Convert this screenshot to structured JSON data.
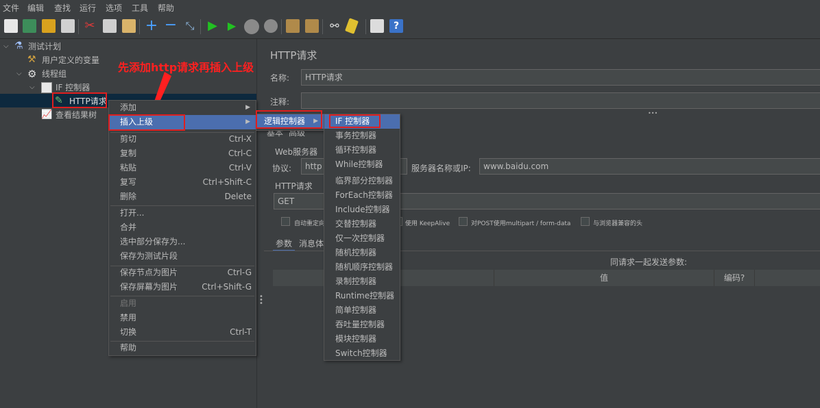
{
  "menubar": [
    "文件",
    "编辑",
    "查找",
    "运行",
    "选项",
    "工具",
    "帮助"
  ],
  "tree": {
    "items": [
      {
        "label": "测试计划"
      },
      {
        "label": "用户定义的变量"
      },
      {
        "label": "线程组"
      },
      {
        "label": "IF 控制器"
      },
      {
        "label": "HTTP请求"
      },
      {
        "label": "查看结果树"
      }
    ]
  },
  "annotation": "先添加http请求再插入上级",
  "context_menu": {
    "items": [
      {
        "label": "添加",
        "submenu": true
      },
      {
        "label": "插入上级",
        "submenu": true,
        "selected": true
      },
      {
        "label": "剪切",
        "shortcut": "Ctrl-X"
      },
      {
        "label": "复制",
        "shortcut": "Ctrl-C"
      },
      {
        "label": "粘贴",
        "shortcut": "Ctrl-V"
      },
      {
        "label": "复写",
        "shortcut": "Ctrl+Shift-C"
      },
      {
        "label": "删除",
        "shortcut": "Delete"
      },
      {
        "label": "打开..."
      },
      {
        "label": "合并"
      },
      {
        "label": "选中部分保存为..."
      },
      {
        "label": "保存为测试片段"
      },
      {
        "label": "保存节点为图片",
        "shortcut": "Ctrl-G"
      },
      {
        "label": "保存屏幕为图片",
        "shortcut": "Ctrl+Shift-G"
      },
      {
        "label": "启用",
        "disabled": true
      },
      {
        "label": "禁用"
      },
      {
        "label": "切换",
        "shortcut": "Ctrl-T"
      },
      {
        "label": "帮助"
      }
    ]
  },
  "submenu1": {
    "label": "逻辑控制器"
  },
  "submenu2": {
    "items": [
      "IF 控制器",
      "事务控制器",
      "循环控制器",
      "While控制器",
      "临界部分控制器",
      "ForEach控制器",
      "Include控制器",
      "交替控制器",
      "仅一次控制器",
      "随机控制器",
      "随机顺序控制器",
      "录制控制器",
      "Runtime控制器",
      "简单控制器",
      "吞吐量控制器",
      "模块控制器",
      "Switch控制器"
    ]
  },
  "panel": {
    "title": "HTTP请求",
    "name_label": "名称:",
    "name_value": "HTTP请求",
    "comment_label": "注释:",
    "tab_basic": "基本",
    "tab_advanced": "高级",
    "web_server": "Web服务器",
    "protocol_label": "协议:",
    "protocol_value": "http",
    "server_label": "服务器名称或IP:",
    "server_value": "www.baidu.com",
    "http_request": "HTTP请求",
    "method": "GET",
    "chk_auto_redirect": "自动重定向",
    "chk_keepalive": "使用 KeepAlive",
    "chk_multipart": "对POST使用multipart / form-data",
    "chk_browser_headers": "与浏览器兼容的头",
    "tab_params": "参数",
    "tab_body": "消息体",
    "send_params": "同请求一起发送参数:",
    "col_value": "值",
    "col_encode": "编码?",
    "ellipsis": "•••"
  },
  "colors": {
    "accent": "#4b6eaf",
    "annotation": "#ff2020",
    "background": "#3c3f41"
  }
}
